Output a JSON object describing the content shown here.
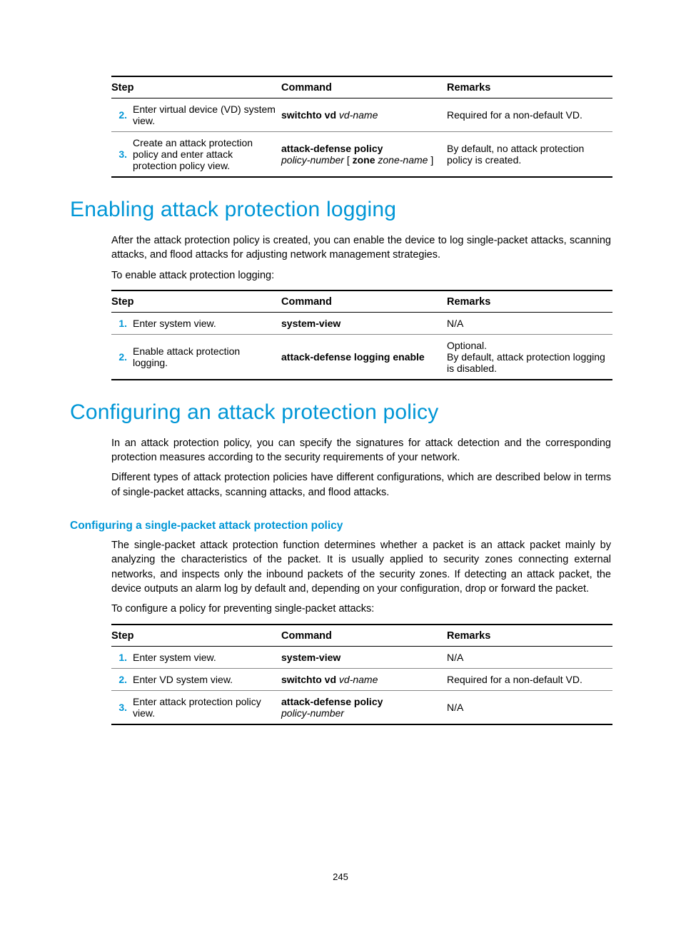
{
  "table1": {
    "headers": {
      "step": "Step",
      "command": "Command",
      "remarks": "Remarks"
    },
    "rows": [
      {
        "num": "2.",
        "desc": "Enter virtual device (VD) system view.",
        "cmd_bold_1": "switchto vd",
        "cmd_ital_1": " vd-name",
        "remarks": "Required for a non-default VD."
      },
      {
        "num": "3.",
        "desc": "Create an attack protection policy and enter attack protection policy view.",
        "cmd_bold_1": "attack-defense policy",
        "cmd_line2_ital_1": "policy-number",
        "cmd_line2_plain_1": " [ ",
        "cmd_line2_bold_1": "zone",
        "cmd_line2_ital_2": " zone-name",
        "cmd_line2_plain_2": " ]",
        "remarks": "By default, no attack protection policy is created."
      }
    ]
  },
  "section1": {
    "title": "Enabling attack protection logging",
    "para1": "After the attack protection policy is created, you can enable the device to log single-packet attacks, scanning attacks, and flood attacks for adjusting network management strategies.",
    "para2": "To enable attack protection logging:"
  },
  "table2": {
    "headers": {
      "step": "Step",
      "command": "Command",
      "remarks": "Remarks"
    },
    "rows": [
      {
        "num": "1.",
        "desc": "Enter system view.",
        "cmd_bold_1": "system-view",
        "remarks": "N/A"
      },
      {
        "num": "2.",
        "desc": "Enable attack protection logging.",
        "cmd_bold_1": "attack-defense logging enable",
        "remarks_line1": "Optional.",
        "remarks_line2": "By default, attack protection logging is disabled."
      }
    ]
  },
  "section2": {
    "title": "Configuring an attack protection policy",
    "para1": "In an attack protection policy, you can specify the signatures for attack detection and the corresponding protection measures according to the security requirements of your network.",
    "para2": "Different types of attack protection policies have different configurations, which are described below in terms of single-packet attacks, scanning attacks, and flood attacks."
  },
  "subsection1": {
    "title": "Configuring a single-packet attack protection policy",
    "para1": "The single-packet attack protection function determines whether a packet is an attack packet mainly by analyzing the characteristics of the packet. It is usually applied to security zones connecting external networks, and inspects only the inbound packets of the security zones. If detecting an attack packet, the device outputs an alarm log by default and, depending on your configuration, drop or forward the packet.",
    "para2": "To configure a policy for preventing single-packet attacks:"
  },
  "table3": {
    "headers": {
      "step": "Step",
      "command": "Command",
      "remarks": "Remarks"
    },
    "rows": [
      {
        "num": "1.",
        "desc": "Enter system view.",
        "cmd_bold_1": "system-view",
        "remarks": "N/A"
      },
      {
        "num": "2.",
        "desc": "Enter VD system view.",
        "cmd_bold_1": "switchto vd",
        "cmd_ital_1": " vd-name",
        "remarks": "Required for a non-default VD."
      },
      {
        "num": "3.",
        "desc": "Enter attack protection policy view.",
        "cmd_bold_1": "attack-defense policy",
        "cmd_line2_ital_1": "policy-number",
        "remarks": "N/A"
      }
    ]
  },
  "pageNumber": "245"
}
